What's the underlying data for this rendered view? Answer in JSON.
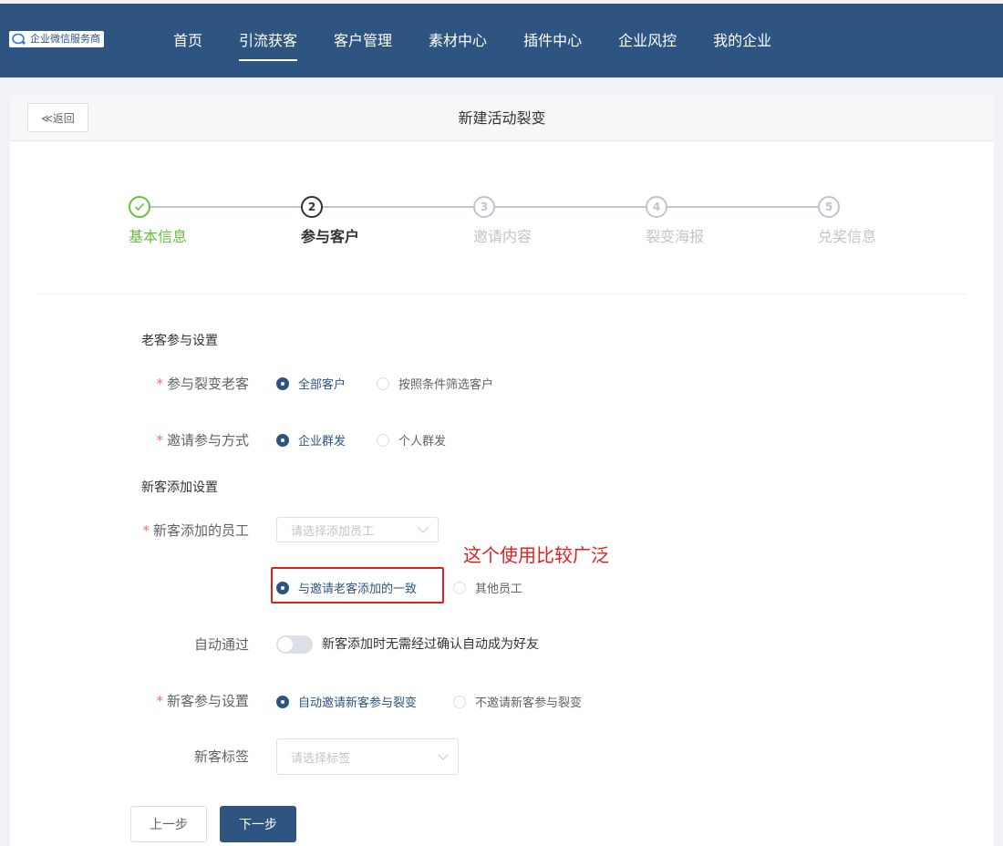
{
  "app": {
    "brand_name": "企业微信服务商",
    "brand_color": "#2e5481"
  },
  "nav": {
    "items": [
      {
        "label": "首页"
      },
      {
        "label": "引流获客",
        "active": true
      },
      {
        "label": "客户管理"
      },
      {
        "label": "素材中心"
      },
      {
        "label": "插件中心"
      },
      {
        "label": "企业风控"
      },
      {
        "label": "我的企业"
      }
    ]
  },
  "page": {
    "back_label": "≪返回",
    "title": "新建活动裂变"
  },
  "steps": [
    {
      "index": "1",
      "title": "基本信息",
      "status": "done",
      "icon": "check-icon"
    },
    {
      "index": "2",
      "title": "参与客户",
      "status": "process"
    },
    {
      "index": "3",
      "title": "邀请内容",
      "status": "wait"
    },
    {
      "index": "4",
      "title": "裂变海报",
      "status": "wait"
    },
    {
      "index": "5",
      "title": "兑奖信息",
      "status": "wait"
    }
  ],
  "form": {
    "old_section_title": "老客参与设置",
    "participants": {
      "label": "参与裂变老客",
      "required": true,
      "options": [
        "全部客户",
        "按照条件筛选客户"
      ],
      "selected": "全部客户"
    },
    "invite_method": {
      "label": "邀请参与方式",
      "required": true,
      "options": [
        "企业群发",
        "个人群发"
      ],
      "selected": "企业群发"
    },
    "new_section_title": "新客添加设置",
    "staff": {
      "label": "新客添加的员工",
      "required": true,
      "placeholder": "请选择添加员工",
      "options": [
        "与邀请老客添加的一致",
        "其他员工"
      ],
      "selected": "与邀请老客添加的一致"
    },
    "annotation": "这个使用比较广泛",
    "auto_pass": {
      "label": "自动通过",
      "enabled": false,
      "description": "新客添加时无需经过确认自动成为好友"
    },
    "new_participation": {
      "label": "新客参与设置",
      "required": true,
      "options": [
        "自动邀请新客参与裂变",
        "不邀请新客参与裂变"
      ],
      "selected": "自动邀请新客参与裂变"
    },
    "tags": {
      "label": "新客标签",
      "placeholder": "请选择标签"
    }
  },
  "actions": {
    "prev_label": "上一步",
    "next_label": "下一步"
  },
  "colors": {
    "done": "#67c23a",
    "annotation": "#e02020",
    "required": "#f56c6c"
  }
}
